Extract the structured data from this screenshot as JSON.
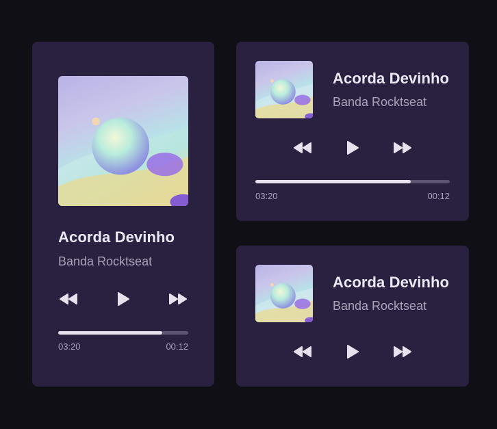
{
  "players": {
    "large": {
      "track_title": "Acorda Devinho",
      "artist": "Banda Rocktseat",
      "elapsed": "03:20",
      "remaining": "00:12",
      "progress": 0.8
    },
    "top": {
      "track_title": "Acorda Devinho",
      "artist": "Banda Rocktseat",
      "elapsed": "03:20",
      "remaining": "00:12",
      "progress": 0.8
    },
    "bottom": {
      "track_title": "Acorda Devinho",
      "artist": "Banda Rocktseat"
    }
  },
  "controls": {
    "previous_icon": "rewind-icon",
    "play_icon": "play-icon",
    "next_icon": "fast-forward-icon"
  },
  "colors": {
    "background": "#110f16",
    "card": "#2a2140",
    "title": "#ece8f3",
    "subtitle": "#a9a2b8",
    "progress_fill": "#e6e1ec",
    "progress_track": "#5c5470"
  }
}
